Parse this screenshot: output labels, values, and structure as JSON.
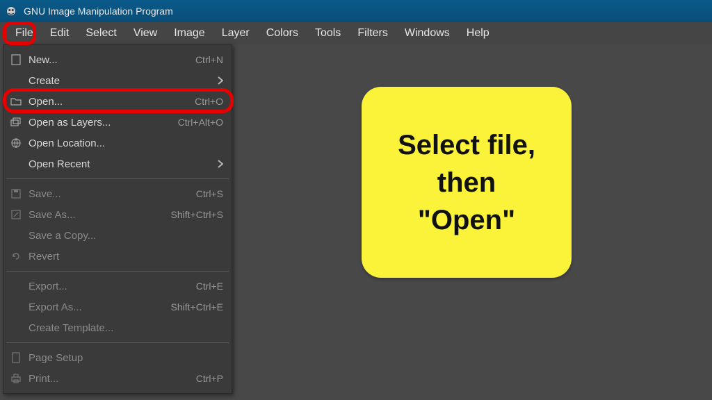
{
  "titlebar": {
    "title": "GNU Image Manipulation Program"
  },
  "menubar": {
    "items": [
      {
        "label": "File"
      },
      {
        "label": "Edit"
      },
      {
        "label": "Select"
      },
      {
        "label": "View"
      },
      {
        "label": "Image"
      },
      {
        "label": "Layer"
      },
      {
        "label": "Colors"
      },
      {
        "label": "Tools"
      },
      {
        "label": "Filters"
      },
      {
        "label": "Windows"
      },
      {
        "label": "Help"
      }
    ]
  },
  "file_menu": {
    "new": {
      "label": "New...",
      "shortcut": "Ctrl+N"
    },
    "create": {
      "label": "Create"
    },
    "open": {
      "label": "Open...",
      "shortcut": "Ctrl+O"
    },
    "open_layers": {
      "label": "Open as Layers...",
      "shortcut": "Ctrl+Alt+O"
    },
    "open_location": {
      "label": "Open Location..."
    },
    "open_recent": {
      "label": "Open Recent"
    },
    "save": {
      "label": "Save...",
      "shortcut": "Ctrl+S"
    },
    "save_as": {
      "label": "Save As...",
      "shortcut": "Shift+Ctrl+S"
    },
    "save_copy": {
      "label": "Save a Copy..."
    },
    "revert": {
      "label": "Revert"
    },
    "export": {
      "label": "Export...",
      "shortcut": "Ctrl+E"
    },
    "export_as": {
      "label": "Export As...",
      "shortcut": "Shift+Ctrl+E"
    },
    "create_tmpl": {
      "label": "Create Template..."
    },
    "page_setup": {
      "label": "Page Setup"
    },
    "print": {
      "label": "Print...",
      "shortcut": "Ctrl+P"
    }
  },
  "callout": {
    "line1": "Select file,",
    "line2": "then",
    "line3": "\"Open\""
  }
}
